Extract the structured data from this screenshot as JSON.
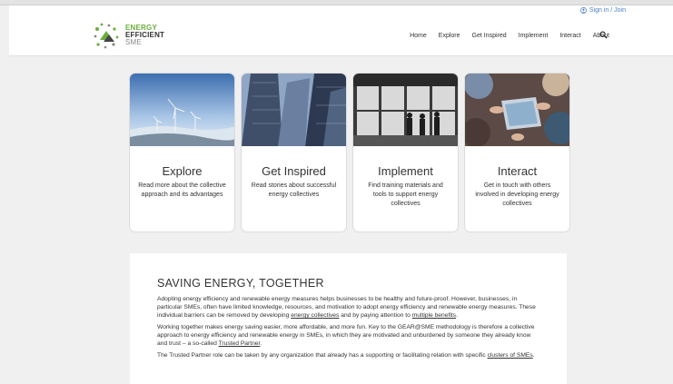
{
  "header": {
    "signin_label": "Sign in / Join",
    "logo": {
      "line1": "ENERGY",
      "line2": "EFFICIENT",
      "line3": "SME"
    },
    "nav": [
      "Home",
      "Explore",
      "Get Inspired",
      "Implement",
      "Interact",
      "About"
    ]
  },
  "cards": [
    {
      "title": "Explore",
      "text": "Read more about the collective approach and its advantages"
    },
    {
      "title": "Get Inspired",
      "text": "Read stories about successful energy collectives"
    },
    {
      "title": "Implement",
      "text": "Find training materials and tools to support energy collectives"
    },
    {
      "title": "Interact",
      "text": "Get in touch with others involved in developing energy collectives"
    }
  ],
  "content": {
    "heading": "SAVING ENERGY, TOGETHER",
    "p1_a": "Adopting energy efficiency and renewable energy measures helps businesses to be healthy and future-proof. However, businesses, in particular SMEs, often have limited knowledge, resources, and motivation to adopt energy efficiency and renewable energy measures. These individual barriers can be removed by developing ",
    "p1_link1": "energy collectives",
    "p1_b": " and by paying attention to ",
    "p1_link2": "multiple benefits",
    "p1_c": ".",
    "p2_a": "Working together makes energy saving easier, more affordable, and more fun. Key to the GEAR@SME methodology is therefore a collective approach to energy efficiency and renewable energy in SMEs, in which they are motivated and unburdened by someone they already know and trust – a so-called ",
    "p2_link": "Trusted Partner",
    "p2_b": ".",
    "p3_a": "The Trusted Partner role can be taken by any organization that already has a supporting or facilitating relation with specific ",
    "p3_link": "clusters of SMEs",
    "p3_b": "."
  }
}
